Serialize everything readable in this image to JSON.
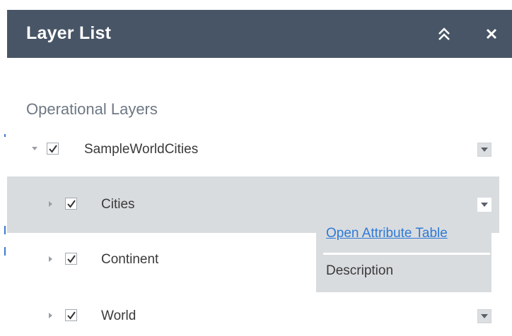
{
  "panel": {
    "title": "Layer List",
    "collapse_icon": "double-chevron-up-icon",
    "close_icon": "close-icon"
  },
  "section": {
    "title": "Operational Layers"
  },
  "layers": [
    {
      "label": "SampleWorldCities",
      "checked": true,
      "expanded": true
    },
    {
      "label": "Cities",
      "checked": true,
      "expanded": false,
      "selected": true
    },
    {
      "label": "Continent",
      "checked": true,
      "expanded": false
    },
    {
      "label": "World",
      "checked": true,
      "expanded": false
    }
  ],
  "context_menu": {
    "items": [
      "Open Attribute Table",
      "Description"
    ]
  },
  "colors": {
    "title_bar": "#485566",
    "selected_row": "#d9dcdf",
    "link": "#2f7ad6"
  }
}
